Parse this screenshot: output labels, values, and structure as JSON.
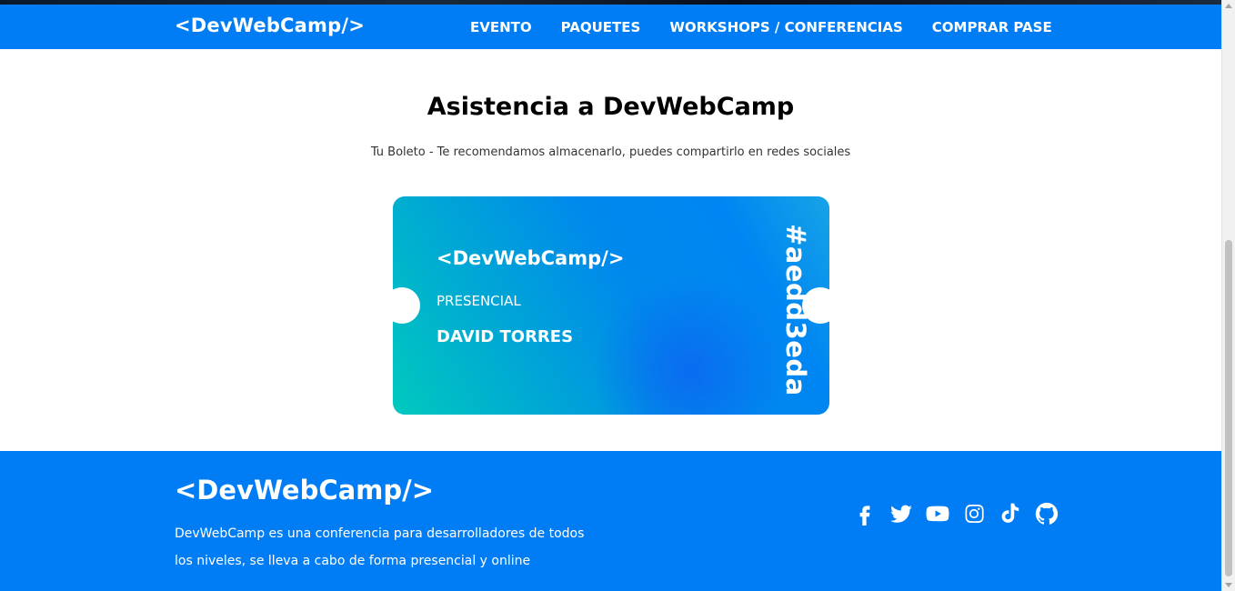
{
  "header": {
    "logo": "<DevWebCamp/>",
    "nav": [
      {
        "label": "EVENTO"
      },
      {
        "label": "PAQUETES"
      },
      {
        "label": "WORKSHOPS / CONFERENCIAS"
      },
      {
        "label": "COMPRAR PASE"
      }
    ]
  },
  "main": {
    "title": "Asistencia a DevWebCamp",
    "subtitle": "Tu Boleto - Te recomendamos almacenarlo, puedes compartirlo en redes sociales",
    "ticket": {
      "logo": "<DevWebCamp/>",
      "type": "PRESENCIAL",
      "name": "DAVID TORRES",
      "code": "#aedd3eda"
    }
  },
  "footer": {
    "logo": "<DevWebCamp/>",
    "description": "DevWebCamp es una conferencia para desarrolladores de todos los niveles, se lleva a cabo de forma presencial y online",
    "social": [
      "facebook-icon",
      "twitter-icon",
      "youtube-icon",
      "instagram-icon",
      "tiktok-icon",
      "github-icon"
    ]
  },
  "colors": {
    "brand_blue": "#007df4",
    "ticket_teal": "#00c9be"
  }
}
